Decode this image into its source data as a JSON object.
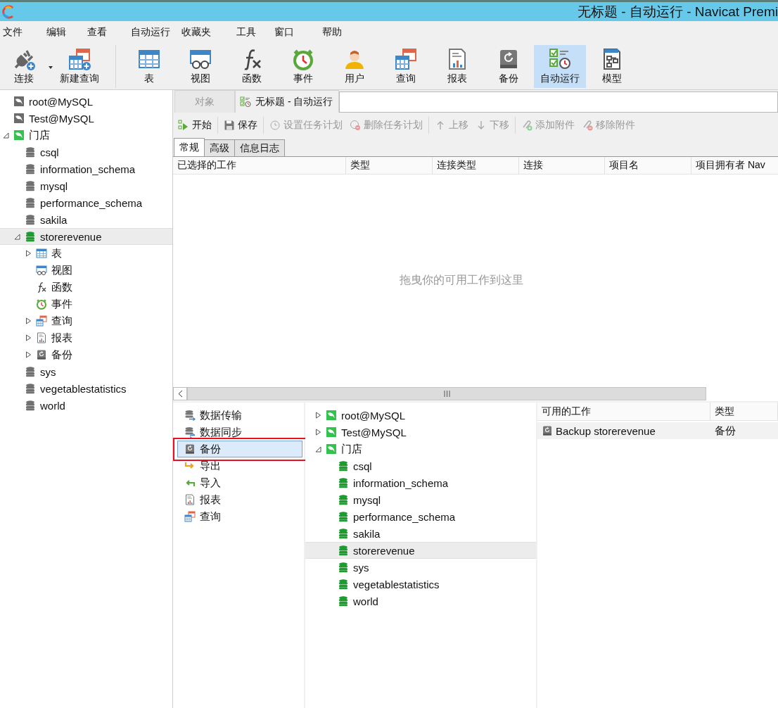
{
  "window": {
    "title": "无标题 - 自动运行 - Navicat Premi"
  },
  "menu": [
    "文件",
    "编辑",
    "查看",
    "自动运行",
    "收藏夹",
    "工具",
    "窗口",
    "帮助"
  ],
  "toolbar": [
    {
      "label": "连接",
      "kind": "connect",
      "selected": false,
      "dropdown": true
    },
    {
      "label": "新建查询",
      "kind": "newquery",
      "selected": false
    },
    {
      "label": "表",
      "kind": "table",
      "selected": false
    },
    {
      "label": "视图",
      "kind": "view",
      "selected": false
    },
    {
      "label": "函数",
      "kind": "function",
      "selected": false
    },
    {
      "label": "事件",
      "kind": "event",
      "selected": false
    },
    {
      "label": "用户",
      "kind": "user",
      "selected": false
    },
    {
      "label": "查询",
      "kind": "query",
      "selected": false
    },
    {
      "label": "报表",
      "kind": "report",
      "selected": false
    },
    {
      "label": "备份",
      "kind": "backup",
      "selected": false
    },
    {
      "label": "自动运行",
      "kind": "automation",
      "selected": true
    },
    {
      "label": "模型",
      "kind": "model",
      "selected": false
    }
  ],
  "sidebar": {
    "tree": [
      {
        "label": "root@MySQL",
        "kind": "conn",
        "selected": false
      },
      {
        "label": "Test@MySQL",
        "kind": "conn",
        "selected": false
      },
      {
        "label": "门店",
        "kind": "connon",
        "selected": false,
        "expanded": true,
        "children": [
          {
            "label": "csql",
            "kind": "db",
            "selected": false
          },
          {
            "label": "information_schema",
            "kind": "db",
            "selected": false
          },
          {
            "label": "mysql",
            "kind": "db",
            "selected": false
          },
          {
            "label": "performance_schema",
            "kind": "db",
            "selected": false
          },
          {
            "label": "sakila",
            "kind": "db",
            "selected": false
          },
          {
            "label": "storerevenue",
            "kind": "dbon",
            "selected": true,
            "expanded": true,
            "children": [
              {
                "label": "表",
                "kind": "table",
                "selected": false,
                "expanded": false
              },
              {
                "label": "视图",
                "kind": "view",
                "selected": false
              },
              {
                "label": "函数",
                "kind": "function",
                "selected": false
              },
              {
                "label": "事件",
                "kind": "event",
                "selected": false
              },
              {
                "label": "查询",
                "kind": "query",
                "selected": false,
                "expanded": false
              },
              {
                "label": "报表",
                "kind": "report",
                "selected": false,
                "expanded": false
              },
              {
                "label": "备份",
                "kind": "backup",
                "selected": false,
                "expanded": false
              }
            ]
          },
          {
            "label": "sys",
            "kind": "db",
            "selected": false
          },
          {
            "label": "vegetablestatistics",
            "kind": "db",
            "selected": false
          },
          {
            "label": "world",
            "kind": "db",
            "selected": false
          }
        ]
      }
    ]
  },
  "doc_tabs": [
    {
      "label": "对象",
      "selected": false
    },
    {
      "label": "无标题 - 自动运行",
      "selected": true,
      "kind": "automation"
    }
  ],
  "actions": [
    {
      "label": "开始",
      "kind": "start",
      "disabled": false
    },
    {
      "label": "保存",
      "kind": "save",
      "disabled": false
    },
    {
      "label": "设置任务计划",
      "kind": "schedule",
      "disabled": true
    },
    {
      "label": "删除任务计划",
      "kind": "unschedule",
      "disabled": true
    },
    {
      "label": "上移",
      "kind": "up",
      "disabled": true
    },
    {
      "label": "下移",
      "kind": "down",
      "disabled": true
    },
    {
      "label": "添加附件",
      "kind": "attach",
      "disabled": true
    },
    {
      "label": "移除附件",
      "kind": "detach",
      "disabled": true
    }
  ],
  "sub_tabs": [
    {
      "label": "常规",
      "selected": true
    },
    {
      "label": "高级",
      "selected": false
    },
    {
      "label": "信息日志",
      "selected": false
    }
  ],
  "selected_jobs": {
    "columns": [
      "已选择的工作",
      "类型",
      "连接类型",
      "连接",
      "项目名",
      "项目拥有者 Nav"
    ],
    "placeholder": "拖曳你的可用工作到这里"
  },
  "job_types": [
    {
      "label": "数据传输",
      "kind": "transfer",
      "selected": false,
      "annotated": false
    },
    {
      "label": "数据同步",
      "kind": "sync",
      "selected": false,
      "annotated": false
    },
    {
      "label": "备份",
      "kind": "backup",
      "selected": true,
      "annotated": true
    },
    {
      "label": "导出",
      "kind": "export",
      "selected": false,
      "annotated": false
    },
    {
      "label": "导入",
      "kind": "import",
      "selected": false,
      "annotated": false
    },
    {
      "label": "报表",
      "kind": "report",
      "selected": false,
      "annotated": false
    },
    {
      "label": "查询",
      "kind": "query",
      "selected": false,
      "annotated": false
    }
  ],
  "object_tree": [
    {
      "label": "root@MySQL",
      "kind": "connon",
      "selected": false,
      "expanded": false
    },
    {
      "label": "Test@MySQL",
      "kind": "connon",
      "selected": false,
      "expanded": false
    },
    {
      "label": "门店",
      "kind": "connon",
      "selected": false,
      "expanded": true,
      "children": [
        {
          "label": "csql",
          "kind": "dbon",
          "selected": false
        },
        {
          "label": "information_schema",
          "kind": "dbon",
          "selected": false
        },
        {
          "label": "mysql",
          "kind": "dbon",
          "selected": false
        },
        {
          "label": "performance_schema",
          "kind": "dbon",
          "selected": false
        },
        {
          "label": "sakila",
          "kind": "dbon",
          "selected": false
        },
        {
          "label": "storerevenue",
          "kind": "dbon",
          "selected": true
        },
        {
          "label": "sys",
          "kind": "dbon",
          "selected": false
        },
        {
          "label": "vegetablestatistics",
          "kind": "dbon",
          "selected": false
        },
        {
          "label": "world",
          "kind": "dbon",
          "selected": false
        }
      ]
    }
  ],
  "available_jobs": {
    "columns": [
      "可用的工作",
      "类型"
    ],
    "rows": [
      {
        "name": "Backup storerevenue",
        "type": "备份",
        "kind": "backup",
        "selected": false
      }
    ]
  }
}
